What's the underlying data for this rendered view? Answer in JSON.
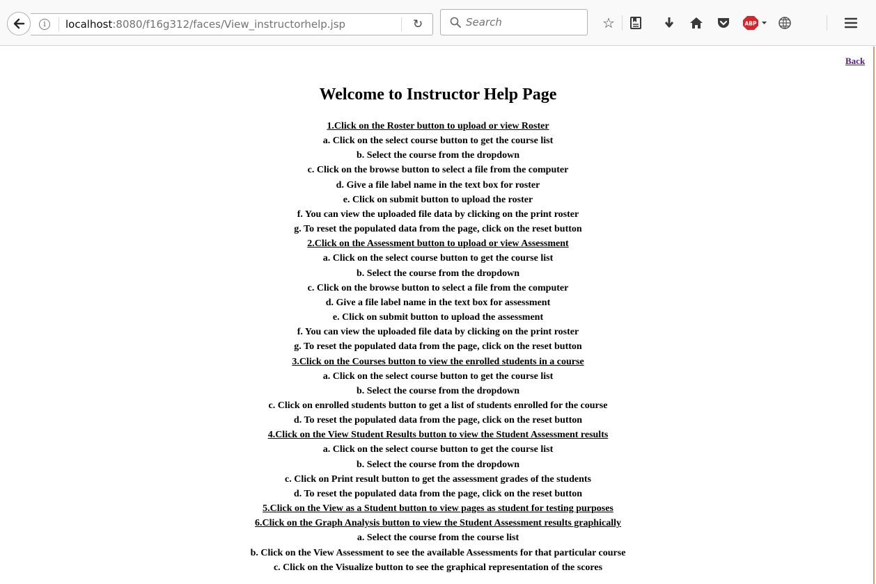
{
  "browser": {
    "url_host": "localhost",
    "url_rest": ":8080/f16g312/faces/View_instructorhelp.jsp",
    "search_placeholder": "Search",
    "adblock_label": "ABP"
  },
  "page": {
    "back_label": "Back",
    "title": "Welcome to Instructor Help Page",
    "lines": [
      {
        "text": "1.Click on the Roster button to upload or view Roster",
        "section": true
      },
      {
        "text": "a. Click on the select course button to get the course list",
        "section": false
      },
      {
        "text": "b. Select the course from the dropdown",
        "section": false
      },
      {
        "text": "c. Click on the browse button to select a file from the computer",
        "section": false
      },
      {
        "text": "d. Give a file label name in the text box for roster",
        "section": false
      },
      {
        "text": "e. Click on submit button to upload the roster",
        "section": false
      },
      {
        "text": "f. You can view the uploaded file data by clicking on the print roster",
        "section": false
      },
      {
        "text": "g. To reset the populated data from the page, click on the reset button",
        "section": false
      },
      {
        "text": "2.Click on the Assessment button to upload or view Assessment",
        "section": true
      },
      {
        "text": "a. Click on the select course button to get the course list",
        "section": false
      },
      {
        "text": "b. Select the course from the dropdown",
        "section": false
      },
      {
        "text": "c. Click on the browse button to select a file from the computer",
        "section": false
      },
      {
        "text": "d. Give a file label name in the text box for assessment",
        "section": false
      },
      {
        "text": "e. Click on submit button to upload the assessment",
        "section": false
      },
      {
        "text": "f. You can view the uploaded file data by clicking on the print roster",
        "section": false
      },
      {
        "text": "g. To reset the populated data from the page, click on the reset button",
        "section": false
      },
      {
        "text": "3.Click on the Courses button to view the enrolled students in a course",
        "section": true
      },
      {
        "text": "a. Click on the select course button to get the course list",
        "section": false
      },
      {
        "text": "b. Select the course from the dropdown",
        "section": false
      },
      {
        "text": "c. Click on enrolled students button to get a list of students enrolled for the course",
        "section": false
      },
      {
        "text": "d. To reset the populated data from the page, click on the reset button",
        "section": false
      },
      {
        "text": "4.Click on the View Student Results button to view the Student Assessment results",
        "section": true
      },
      {
        "text": "a. Click on the select course button to get the course list",
        "section": false
      },
      {
        "text": "b. Select the course from the dropdown",
        "section": false
      },
      {
        "text": "c. Click on Print result button to get the assessment grades of the students",
        "section": false
      },
      {
        "text": "d. To reset the populated data from the page, click on the reset button",
        "section": false
      },
      {
        "text": "5.Click on the View as a Student button to view pages as student for testing purposes",
        "section": true
      },
      {
        "text": "6.Click on the Graph Analysis button to view the Student Assessment results graphically",
        "section": true
      },
      {
        "text": "a. Select the course from the course list",
        "section": false
      },
      {
        "text": "b. Click on the View Assessment to see the available Assessments for that particular course",
        "section": false
      },
      {
        "text": "c. Click on the Visualize button to see the graphical representation of the scores",
        "section": false
      }
    ]
  }
}
